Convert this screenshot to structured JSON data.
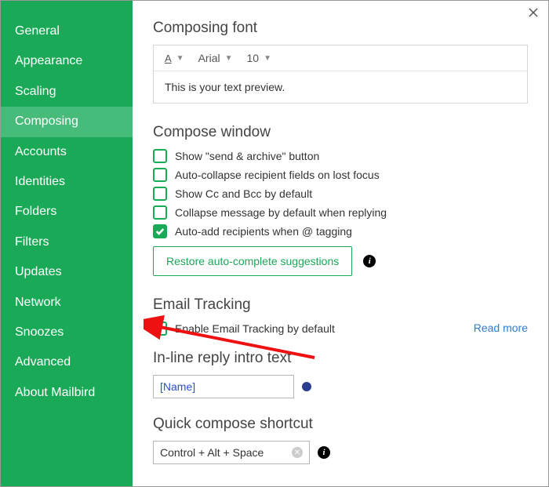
{
  "sidebar": {
    "items": [
      {
        "label": "General"
      },
      {
        "label": "Appearance"
      },
      {
        "label": "Scaling"
      },
      {
        "label": "Composing",
        "active": true
      },
      {
        "label": "Accounts"
      },
      {
        "label": "Identities"
      },
      {
        "label": "Folders"
      },
      {
        "label": "Filters"
      },
      {
        "label": "Updates"
      },
      {
        "label": "Network"
      },
      {
        "label": "Snoozes"
      },
      {
        "label": "Advanced"
      },
      {
        "label": "About Mailbird"
      }
    ]
  },
  "composing_font": {
    "title": "Composing font",
    "font_family": "Arial",
    "font_size": "10",
    "preview_text": "This is your text preview."
  },
  "compose_window": {
    "title": "Compose window",
    "options": [
      {
        "label": "Show \"send & archive\" button",
        "checked": false
      },
      {
        "label": "Auto-collapse recipient fields on lost focus",
        "checked": false
      },
      {
        "label": "Show Cc and Bcc by default",
        "checked": false
      },
      {
        "label": "Collapse message by default when replying",
        "checked": false
      },
      {
        "label": "Auto-add recipients when @ tagging",
        "checked": true
      }
    ],
    "restore_label": "Restore auto-complete suggestions"
  },
  "email_tracking": {
    "title": "Email Tracking",
    "option_label": "Enable Email Tracking by default",
    "option_checked": false,
    "read_more": "Read more"
  },
  "inline_reply": {
    "title": "In-line reply intro text",
    "value": "[Name]"
  },
  "quick_compose": {
    "title": "Quick compose shortcut",
    "value": "Control + Alt + Space"
  }
}
